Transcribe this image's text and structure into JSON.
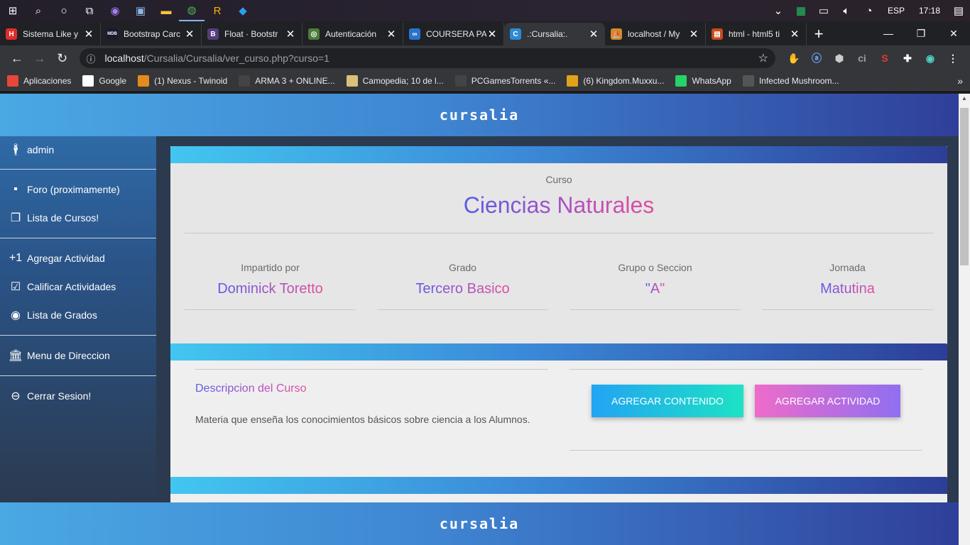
{
  "taskbar": {
    "icons": [
      "windows-icon",
      "search-icon",
      "cortana-icon",
      "task-view-icon",
      "app-icon",
      "photos-icon",
      "explorer-icon",
      "chrome-icon",
      "rockstar-icon",
      "vscode-icon"
    ],
    "tray": {
      "lang": "ESP",
      "time": "17:18"
    }
  },
  "tabs": [
    {
      "title": "Sistema Like y",
      "fav": "H",
      "color": "#e02c2c"
    },
    {
      "title": "Bootstrap Carc",
      "fav": "MDB",
      "color": "#1a1a2e"
    },
    {
      "title": "Float · Bootstr",
      "fav": "B",
      "color": "#563d7c"
    },
    {
      "title": "Autenticación",
      "fav": "◎",
      "color": "#4a7c3a"
    },
    {
      "title": "COURSERA PA",
      "fav": "∞",
      "color": "#2a73cc"
    },
    {
      "title": ".:Cursalia:.",
      "fav": "C",
      "color": "#2b8bd6"
    },
    {
      "title": "localhost / My",
      "fav": "⛵",
      "color": "#d18b2a"
    },
    {
      "title": "html - html5 ti",
      "fav": "▤",
      "color": "#c84a1c"
    }
  ],
  "active_tab": 5,
  "address": {
    "host": "localhost",
    "path": "/Cursalia/Cursalia/ver_curso.php?curso=1"
  },
  "bookmarks": [
    {
      "label": "Aplicaciones",
      "color": "#e8463a"
    },
    {
      "label": "Google",
      "color": "#ffffff"
    },
    {
      "label": "(1) Nexus - Twinoid",
      "color": "#e58a1d"
    },
    {
      "label": "ARMA 3 + ONLINE...",
      "color": "#444"
    },
    {
      "label": "Camopedia; 10 de l...",
      "color": "#d8c27a"
    },
    {
      "label": "PCGamesTorrents «...",
      "color": "#444"
    },
    {
      "label": "(6) Kingdom.Muxxu...",
      "color": "#e0a21a"
    },
    {
      "label": "WhatsApp",
      "color": "#25d366"
    },
    {
      "label": "Infected Mushroom...",
      "color": "#555"
    }
  ],
  "site": {
    "logo": "cursalia"
  },
  "sidebar": {
    "user": "admin",
    "items": [
      {
        "label": "Foro (proximamente)",
        "icon": "chat-icon"
      },
      {
        "label": "Lista de Cursos!",
        "icon": "library-icon"
      },
      {
        "label": "Agregar Actividad",
        "icon": "plus-one-icon"
      },
      {
        "label": "Calificar Actividades",
        "icon": "clipboard-check-icon"
      },
      {
        "label": "Lista de Grados",
        "icon": "account-circle-icon"
      },
      {
        "label": "Menu de Direccion",
        "icon": "bank-icon"
      },
      {
        "label": "Cerrar Sesion!",
        "icon": "minus-circle-icon"
      }
    ]
  },
  "course": {
    "label": "Curso",
    "name": "Ciencias Naturales",
    "info": [
      {
        "label": "Impartido por",
        "value": "Dominick Toretto"
      },
      {
        "label": "Grado",
        "value": "Tercero Basico"
      },
      {
        "label": "Grupo o Seccion",
        "value": "\"A\""
      },
      {
        "label": "Jornada",
        "value": "Matutina"
      }
    ],
    "desc_title": "Descripcion del Curso",
    "desc_text": "Materia que enseña los conocimientos básicos sobre ciencia a los Alumnos.",
    "btn_add_content": "AGREGAR CONTENIDO",
    "btn_add_activity": "AGREGAR ACTIVIDAD"
  }
}
